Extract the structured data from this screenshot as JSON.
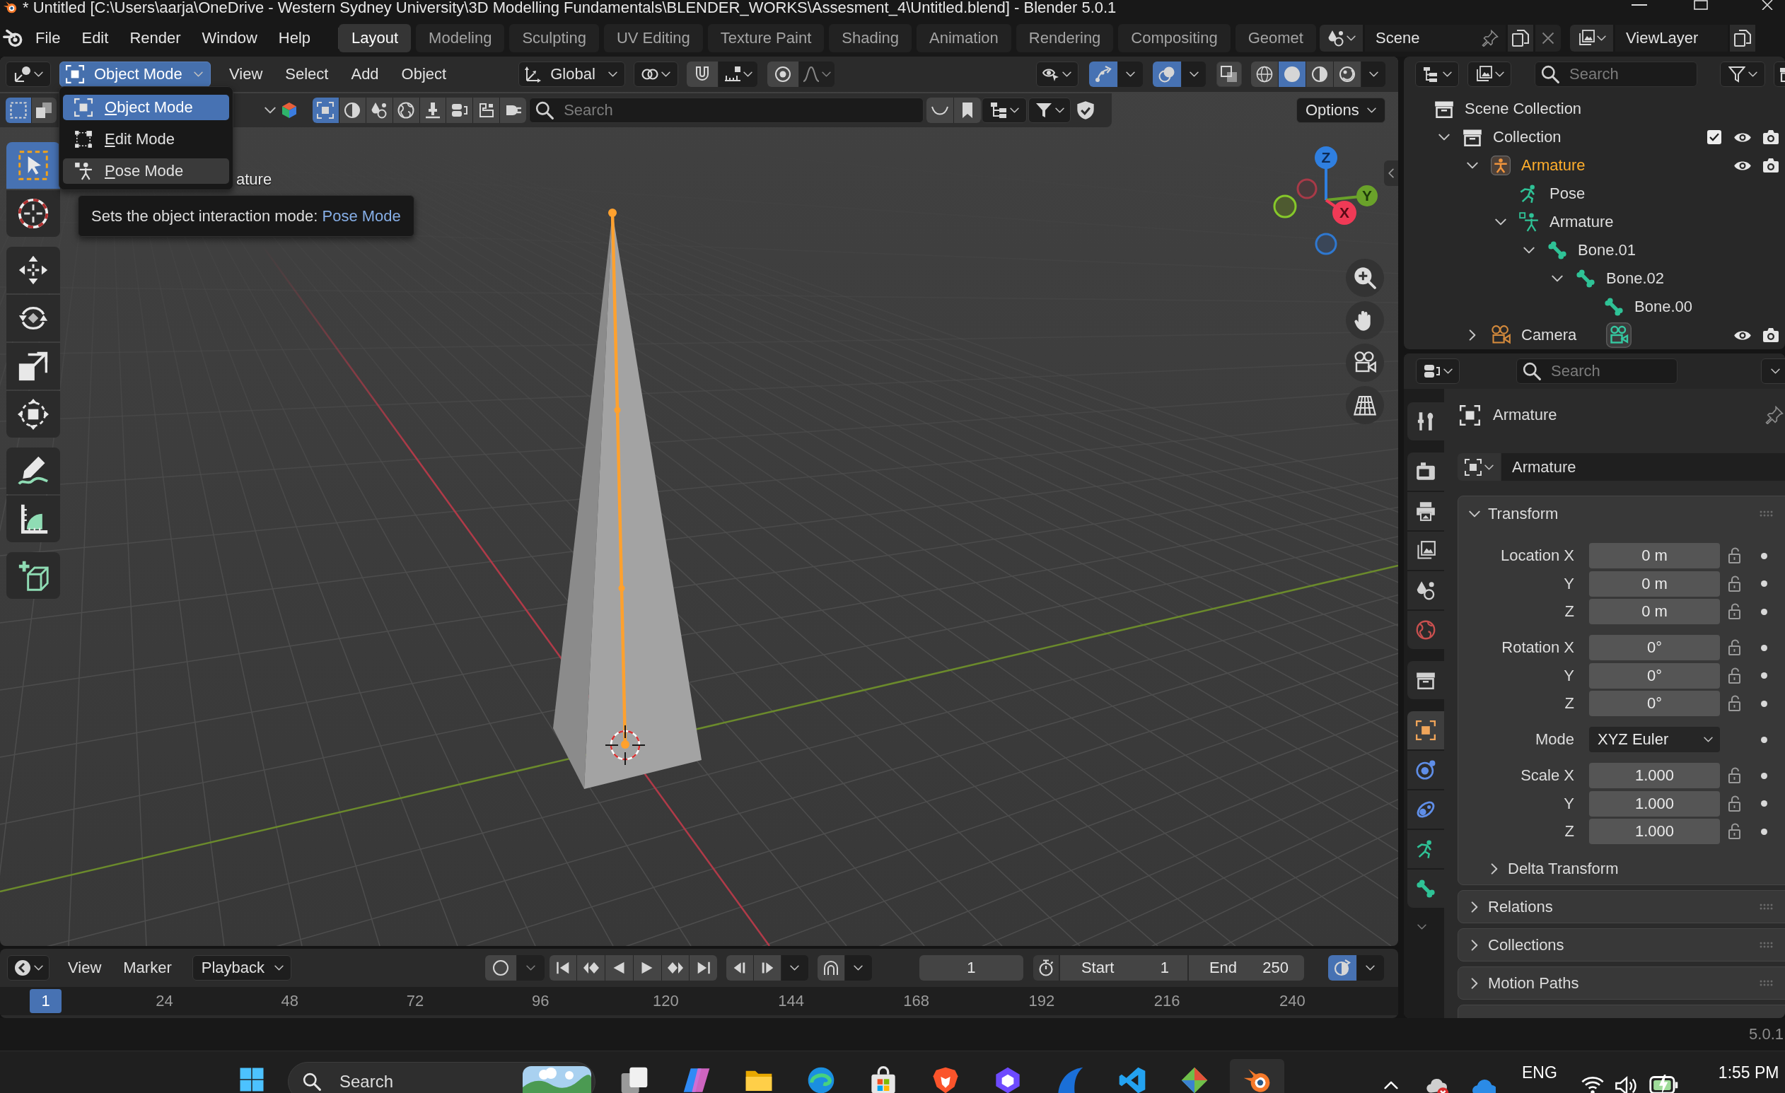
{
  "title_bar": {
    "title": "* Untitled [C:\\Users\\aarja\\OneDrive - Western Sydney University\\3D Modelling Fundamentals\\BLENDER_WORKS\\Assesment_4\\Untitled.blend] - Blender 5.0.1"
  },
  "top_bar": {
    "menus": [
      "File",
      "Edit",
      "Render",
      "Window",
      "Help"
    ],
    "workspaces": [
      {
        "label": "Layout",
        "selected": true
      },
      {
        "label": "Modeling",
        "selected": false
      },
      {
        "label": "Sculpting",
        "selected": false
      },
      {
        "label": "UV Editing",
        "selected": false
      },
      {
        "label": "Texture Paint",
        "selected": false
      },
      {
        "label": "Shading",
        "selected": false
      },
      {
        "label": "Animation",
        "selected": false
      },
      {
        "label": "Rendering",
        "selected": false
      },
      {
        "label": "Compositing",
        "selected": false
      },
      {
        "label": "Geomet",
        "selected": false
      }
    ],
    "scene": "Scene",
    "view_layer": "ViewLayer"
  },
  "viewport_header": {
    "mode": "Object Mode",
    "menus": [
      "View",
      "Select",
      "Add",
      "Object"
    ],
    "orientation": "Global",
    "snap": false,
    "proportional_editing": false,
    "gizmos": true,
    "overlays": true,
    "xray": false,
    "shading": [
      {
        "kind": "wireframe",
        "selected": false
      },
      {
        "kind": "solid",
        "selected": true
      },
      {
        "kind": "material",
        "selected": false
      },
      {
        "kind": "rendered",
        "selected": false
      }
    ]
  },
  "tool_header": {
    "select_modes": [
      {
        "kind": "set",
        "selected": true
      },
      {
        "kind": "extend",
        "selected": false
      }
    ],
    "filters": [
      {
        "kind": "square",
        "selected": true
      },
      {
        "kind": "half_circle",
        "selected": false
      },
      {
        "kind": "drops",
        "selected": false
      },
      {
        "kind": "globe",
        "selected": false
      },
      {
        "kind": "brush",
        "selected": false
      },
      {
        "kind": "toggle",
        "selected": false
      },
      {
        "kind": "stamp",
        "selected": false
      },
      {
        "kind": "plug",
        "selected": false
      }
    ],
    "search": {
      "placeholder": "Search"
    },
    "options": "Options"
  },
  "mode_menu": {
    "items": [
      {
        "label": "Object Mode",
        "kind": "object",
        "selected": true,
        "hovered": false
      },
      {
        "label": "Edit Mode",
        "kind": "edit",
        "selected": false,
        "hovered": false
      },
      {
        "label": "Pose Mode",
        "kind": "pose",
        "selected": false,
        "hovered": true
      }
    ]
  },
  "tooltip": {
    "text": "Sets the object interaction mode:",
    "value": "Pose Mode"
  },
  "viewport": {
    "object_info": "ature",
    "tool_groups": [
      {
        "tools": [
          {
            "kind": "select_box",
            "selected": true
          },
          {
            "kind": "cursor",
            "selected": false
          }
        ]
      },
      {
        "tools": [
          {
            "kind": "move",
            "selected": false
          },
          {
            "kind": "rotate",
            "selected": false
          },
          {
            "kind": "scale",
            "selected": false
          },
          {
            "kind": "transform",
            "selected": false
          }
        ]
      },
      {
        "tools": [
          {
            "kind": "annotate",
            "selected": false
          },
          {
            "kind": "measure",
            "selected": false
          }
        ]
      },
      {
        "tools": [
          {
            "kind": "add_cube",
            "selected": false
          }
        ]
      }
    ],
    "gizmo_axes": [
      {
        "kind": "z",
        "label": "Z"
      },
      {
        "kind": "y",
        "label": "Y"
      },
      {
        "kind": "x",
        "label": "X"
      }
    ]
  },
  "outliner": {
    "search": {
      "placeholder": "Search"
    },
    "tree": [
      {
        "label": "Scene Collection",
        "kind": "scene_collection",
        "selected": false,
        "children": [
          {
            "label": "Collection",
            "kind": "collection",
            "selected": false,
            "expanded": true,
            "checked": true,
            "visible": true,
            "children": [
              {
                "label": "Armature",
                "kind": "armature",
                "selected": true,
                "expanded": true,
                "visible": true,
                "children": [
                  {
                    "label": "Pose",
                    "kind": "pose",
                    "selected": false
                  },
                  {
                    "label": "Armature",
                    "kind": "armature_data",
                    "selected": false,
                    "expanded": true,
                    "children": [
                      {
                        "label": "Bone.01",
                        "kind": "bone",
                        "selected": false,
                        "expanded": true,
                        "children": [
                          {
                            "label": "Bone.02",
                            "kind": "bone",
                            "selected": false,
                            "expanded": true,
                            "children": [
                              {
                                "label": "Bone.00",
                                "kind": "bone",
                                "selected": false
                              }
                            ]
                          }
                        ]
                      }
                    ]
                  }
                ]
              },
              {
                "label": "Camera",
                "kind": "camera",
                "selected": false,
                "expanded": false,
                "visible": true
              }
            ]
          }
        ]
      }
    ]
  },
  "properties": {
    "search": {
      "placeholder": "Search"
    },
    "tab_groups": [
      {
        "tabs": [
          {
            "kind": "tool",
            "selected": false
          }
        ]
      },
      {
        "tabs": [
          {
            "kind": "render",
            "selected": false
          },
          {
            "kind": "output",
            "selected": false
          },
          {
            "kind": "view_layer",
            "selected": false
          },
          {
            "kind": "scene",
            "selected": false
          },
          {
            "kind": "world",
            "selected": false
          }
        ]
      },
      {
        "tabs": [
          {
            "kind": "collection",
            "selected": false
          }
        ]
      },
      {
        "tabs": [
          {
            "kind": "object",
            "selected": true
          },
          {
            "kind": "physics",
            "selected": false
          },
          {
            "kind": "constraints",
            "selected": false
          },
          {
            "kind": "data",
            "selected": false
          },
          {
            "kind": "bone",
            "selected": false
          }
        ]
      }
    ],
    "context": "Armature",
    "name": "Armature",
    "transform": {
      "title": "Transform",
      "expanded": true,
      "groups": [
        {
          "rows": [
            {
              "label": "Location X",
              "value": "0 m",
              "kind": "number",
              "locked": false
            },
            {
              "label": "Y",
              "value": "0 m",
              "kind": "number",
              "locked": false
            },
            {
              "label": "Z",
              "value": "0 m",
              "kind": "number",
              "locked": false
            }
          ]
        },
        {
          "rows": [
            {
              "label": "Rotation X",
              "value": "0°",
              "kind": "number",
              "locked": false
            },
            {
              "label": "Y",
              "value": "0°",
              "kind": "number",
              "locked": false
            },
            {
              "label": "Z",
              "value": "0°",
              "kind": "number",
              "locked": false
            }
          ]
        },
        {
          "rows": [
            {
              "label": "Mode",
              "value": "XYZ Euler",
              "kind": "dropdown"
            }
          ]
        },
        {
          "rows": [
            {
              "label": "Scale X",
              "value": "1.000",
              "kind": "number",
              "locked": false
            },
            {
              "label": "Y",
              "value": "1.000",
              "kind": "number",
              "locked": false
            },
            {
              "label": "Z",
              "value": "1.000",
              "kind": "number",
              "locked": false
            }
          ]
        }
      ],
      "subpanels": [
        {
          "title": "Delta Transform",
          "expanded": false
        }
      ]
    },
    "panels": [
      {
        "title": "Relations",
        "expanded": false
      },
      {
        "title": "Collections",
        "expanded": false
      },
      {
        "title": "Motion Paths",
        "expanded": false
      }
    ]
  },
  "timeline": {
    "menus": [
      "View",
      "Marker"
    ],
    "playback": "Playback",
    "auto_keying": false,
    "current_frame": "1",
    "start_label": "Start",
    "start": "1",
    "end_label": "End",
    "end": "250",
    "sync": true,
    "ruler": {
      "current": "1",
      "ticks": [
        "24",
        "48",
        "72",
        "96",
        "120",
        "144",
        "168",
        "192",
        "216",
        "240"
      ]
    }
  },
  "status_bar": {
    "version": "5.0.1"
  },
  "taskbar": {
    "search": {
      "placeholder": "Search"
    },
    "apps": [
      {
        "kind": "task_view",
        "selected": false
      },
      {
        "kind": "copilot",
        "selected": false
      },
      {
        "kind": "explorer",
        "selected": false
      },
      {
        "kind": "edge",
        "selected": false
      },
      {
        "kind": "store",
        "selected": false
      },
      {
        "kind": "brave",
        "selected": false
      },
      {
        "kind": "vpn",
        "selected": false
      },
      {
        "kind": "fin",
        "selected": false
      },
      {
        "kind": "vscode",
        "selected": false
      },
      {
        "kind": "diamond",
        "selected": false
      },
      {
        "kind": "blender",
        "selected": true
      }
    ],
    "language": "ENG",
    "time": "1:55 PM"
  }
}
